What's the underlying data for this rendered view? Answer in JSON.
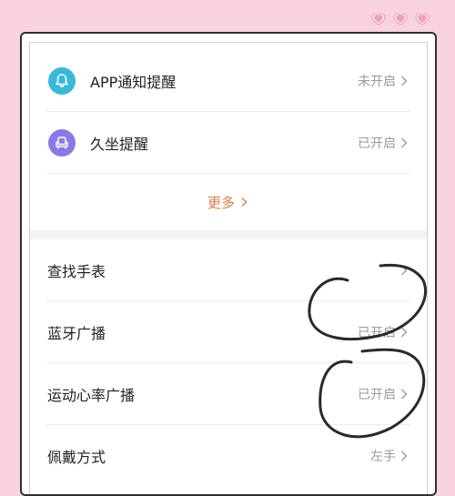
{
  "colors": {
    "background": "#f8d3df",
    "app_notify_icon_bg": "#38b9d8",
    "sedentary_icon_bg": "#8a79e6",
    "more_link": "#e07b3c",
    "value_text": "#9a9a9a",
    "scribble": "#2a2a2a"
  },
  "notifications": {
    "items": [
      {
        "label": "APP通知提醒",
        "value": "未开启",
        "icon": "bell-icon"
      },
      {
        "label": "久坐提醒",
        "value": "已开启",
        "icon": "armchair-icon"
      }
    ],
    "more_label": "更多"
  },
  "settings": {
    "items": [
      {
        "label": "查找手表",
        "value": ""
      },
      {
        "label": "蓝牙广播",
        "value": "已开启"
      },
      {
        "label": "运动心率广播",
        "value": "已开启"
      },
      {
        "label": "佩戴方式",
        "value": "左手"
      }
    ]
  }
}
